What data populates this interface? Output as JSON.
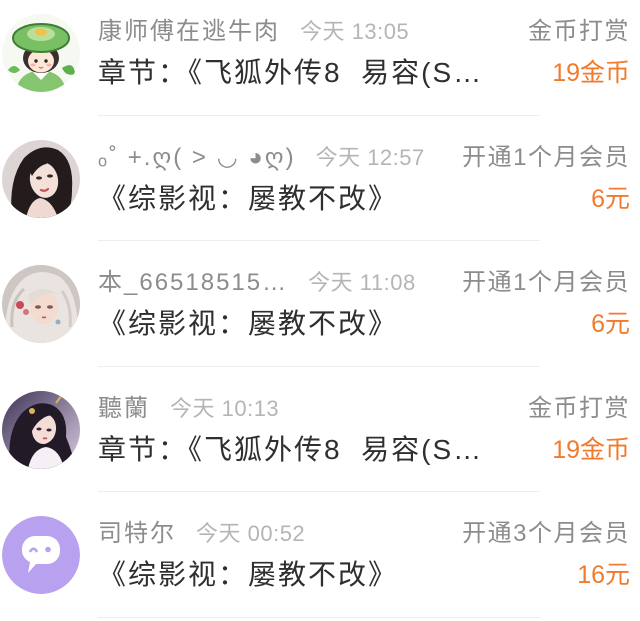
{
  "items": [
    {
      "username": "康师傅在逃牛肉",
      "time": "今天 13:05",
      "type": "金币打赏",
      "content": "章节：《飞狐外传8  易容(S…",
      "amount": "19金币"
    },
    {
      "username": "ₒ˚ +.ღ( ˃ ◡ ◕ღ)",
      "time": "今天 12:57",
      "type": "开通1个月会员",
      "content": "《综影视：屡教不改》",
      "amount": "6元"
    },
    {
      "username": "本_66518515…",
      "time": "今天 11:08",
      "type": "开通1个月会员",
      "content": "《综影视：屡教不改》",
      "amount": "6元"
    },
    {
      "username": "聽蘭",
      "time": "今天 10:13",
      "type": "金币打赏",
      "content": "章节：《飞狐外传8  易容(S…",
      "amount": "19金币"
    },
    {
      "username": "司特尔",
      "time": "今天 00:52",
      "type": "开通3个月会员",
      "content": "《综影视：屡教不改》",
      "amount": "16元",
      "avatar_icon": "chat-bubble-icon"
    }
  ],
  "colors": {
    "username": "#8c8c8c",
    "time": "#b5b5b5",
    "type": "#8c8c8c",
    "content": "#2f2f2f",
    "amount": "#f27a2c",
    "divider": "#eeeeee"
  }
}
